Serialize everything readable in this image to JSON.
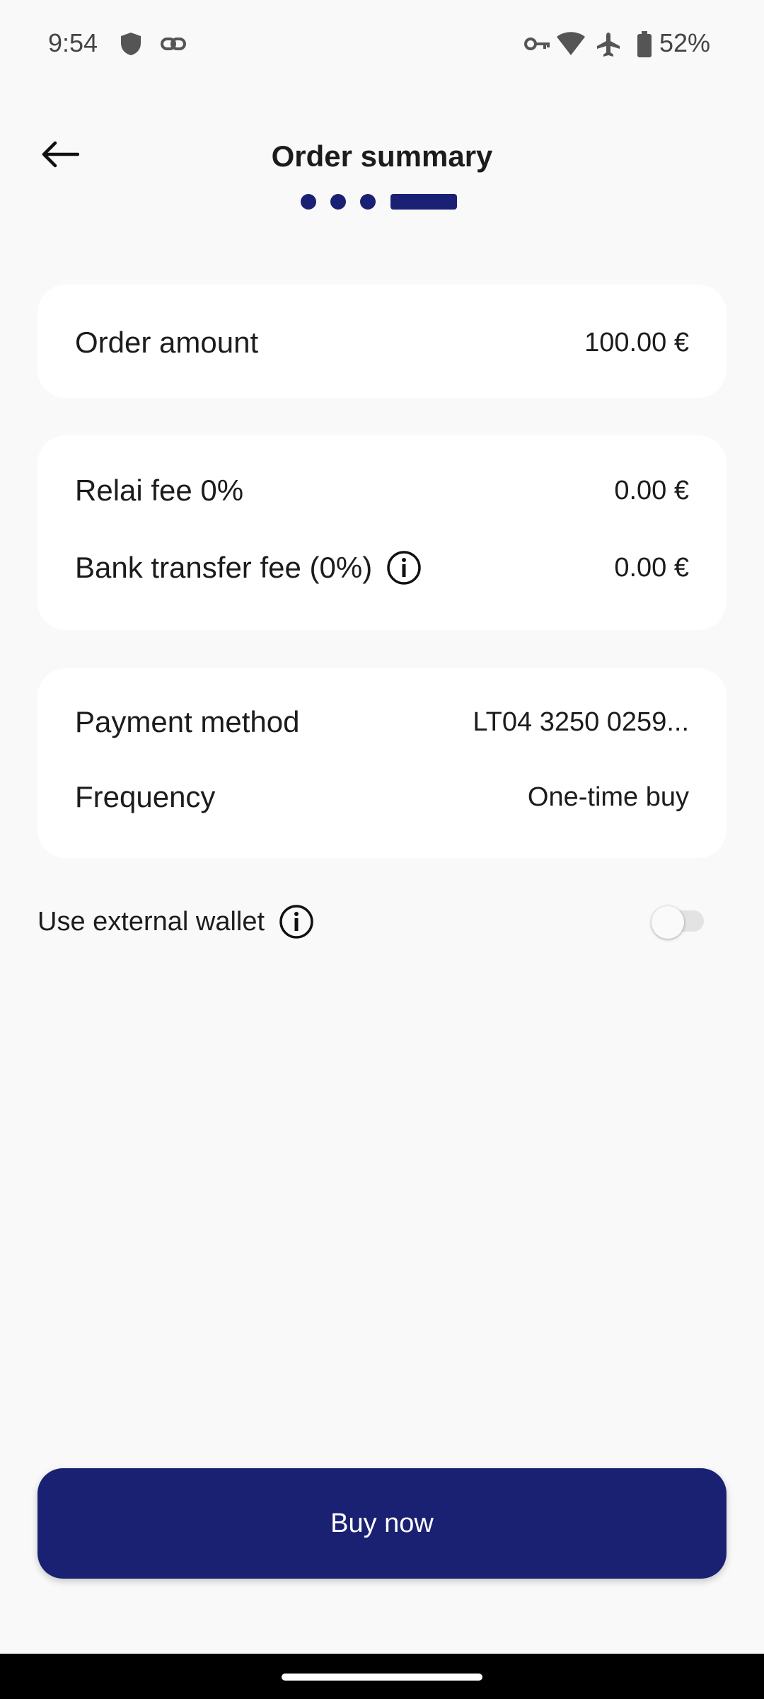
{
  "status_bar": {
    "time": "9:54",
    "battery_percent": "52%",
    "icons": [
      "shield-icon",
      "link-icon",
      "vpn-key-icon",
      "wifi-icon",
      "airplane-icon",
      "battery-icon"
    ]
  },
  "header": {
    "title": "Order summary",
    "back_icon": "arrow-left-icon",
    "steps_total": 4,
    "current_step": 4
  },
  "amount_card": {
    "label": "Order amount",
    "value": "100.00 €"
  },
  "fees_card": {
    "relai_fee_label": "Relai fee 0%",
    "relai_fee_value": "0.00 €",
    "bank_fee_label": "Bank transfer fee (0%)",
    "bank_fee_value": "0.00 €"
  },
  "payment_card": {
    "method_label": "Payment method",
    "method_value": "LT04 3250 0259...",
    "frequency_label": "Frequency",
    "frequency_value": "One-time buy"
  },
  "external_wallet": {
    "label": "Use external wallet",
    "enabled": false
  },
  "buy_button": {
    "label": "Buy now"
  },
  "colors": {
    "accent": "#1a2072",
    "background": "#f9f9f9",
    "card": "#ffffff"
  }
}
